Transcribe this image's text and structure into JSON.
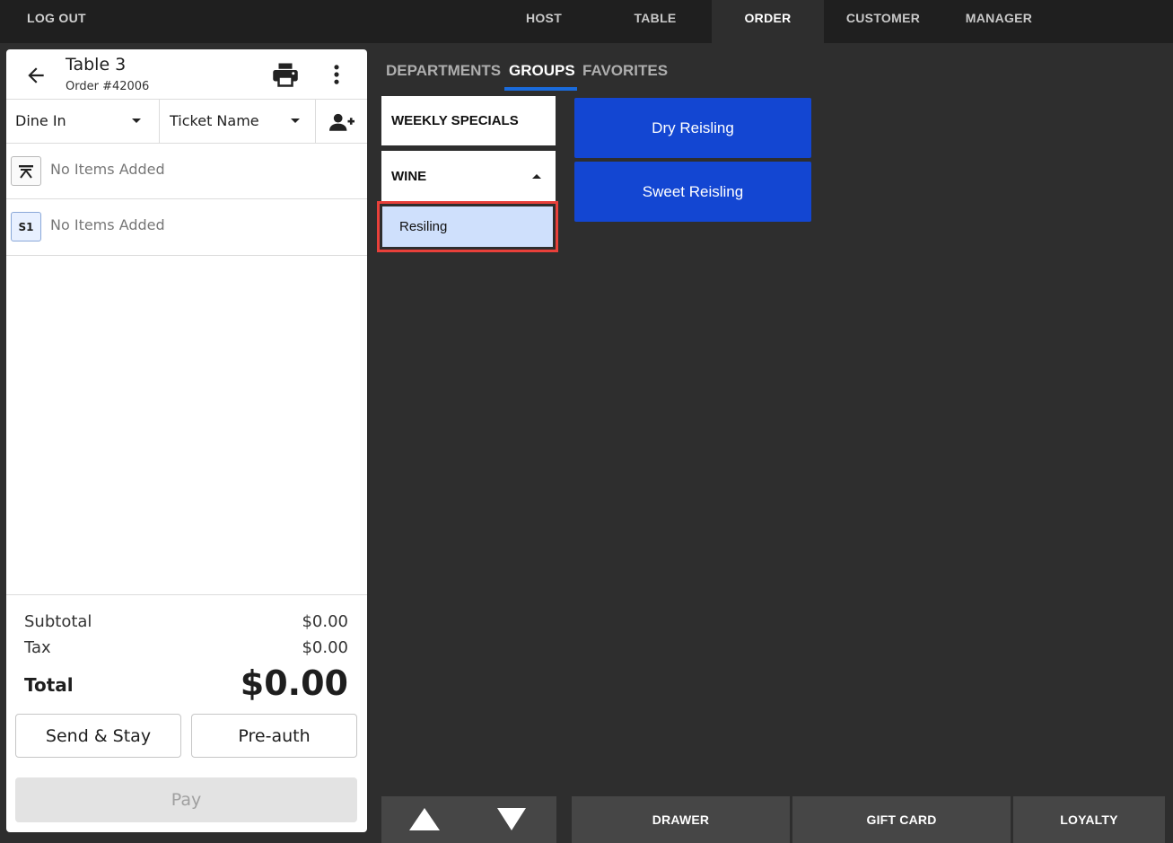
{
  "topbar": {
    "logout": "LOG OUT",
    "tabs": [
      {
        "label": "HOST"
      },
      {
        "label": "TABLE"
      },
      {
        "label": "ORDER"
      },
      {
        "label": "CUSTOMER"
      },
      {
        "label": "MANAGER"
      }
    ],
    "active_tab": "ORDER"
  },
  "order": {
    "table": "Table 3",
    "order_number": "Order #42006",
    "dining_option": "Dine In",
    "ticket_name": "Ticket Name",
    "seats": [
      {
        "badge_icon": "table-icon",
        "badge": "",
        "text": "No Items Added"
      },
      {
        "badge": "S1",
        "text": "No Items Added"
      }
    ],
    "subtotal_label": "Subtotal",
    "subtotal": "$0.00",
    "tax_label": "Tax",
    "tax": "$0.00",
    "total_label": "Total",
    "total": "$0.00",
    "send_stay": "Send & Stay",
    "preauth": "Pre-auth",
    "pay": "Pay"
  },
  "menu": {
    "subtabs": [
      {
        "label": "DEPARTMENTS"
      },
      {
        "label": "GROUPS"
      },
      {
        "label": "FAVORITES"
      }
    ],
    "active_subtab": "GROUPS",
    "groups": [
      {
        "label": "WEEKLY SPECIALS"
      },
      {
        "label": "WINE",
        "expanded": true,
        "children": [
          {
            "label": "Resiling",
            "selected": true
          }
        ]
      }
    ],
    "items": [
      {
        "label": "Dry Reisling"
      },
      {
        "label": "Sweet Reisling"
      }
    ]
  },
  "bottom_bar": {
    "drawer": "DRAWER",
    "gift_card": "GIFT CARD",
    "loyalty": "LOYALTY"
  },
  "colors": {
    "accent": "#1346d2",
    "selected_bg": "#cfe0fc",
    "highlight_border": "#e8403a",
    "dark_bg": "#2e2e2e",
    "topbar_bg": "#1f1f1f"
  }
}
